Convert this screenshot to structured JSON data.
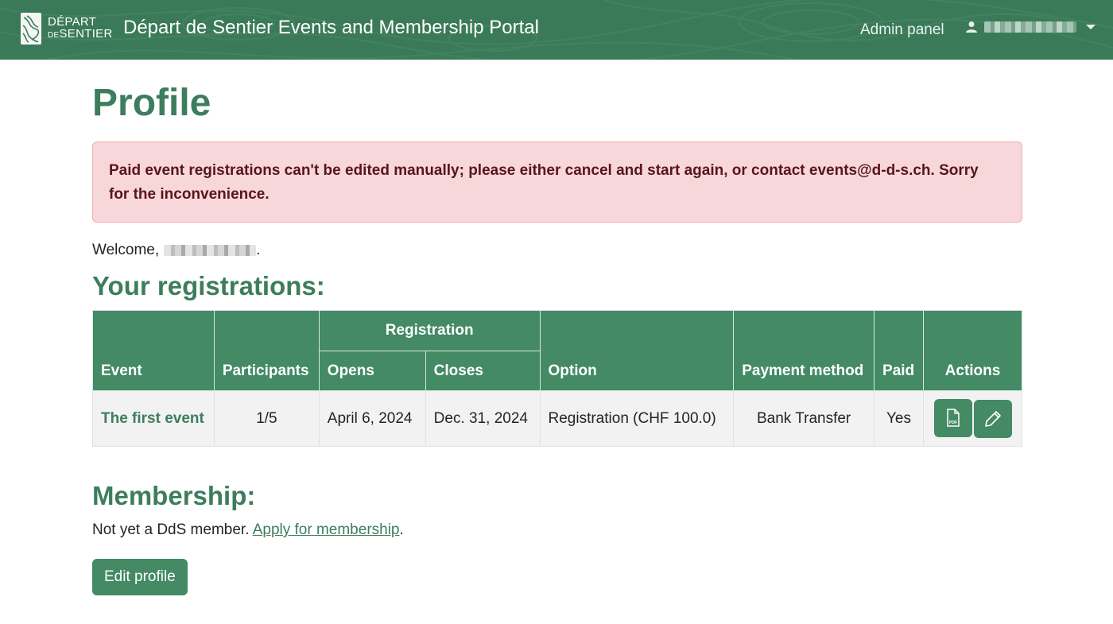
{
  "navbar": {
    "brand_line1": "DÉPART",
    "brand_line2_small": "DE",
    "brand_line2": "SENTIER",
    "title": "Départ de Sentier Events and Membership Portal",
    "admin_link": "Admin panel",
    "user_icon": "user-icon",
    "dropdown_icon": "chevron-down-icon"
  },
  "page": {
    "title": "Profile"
  },
  "alert": {
    "message": "Paid event registrations can't be edited manually; please either cancel and start again, or contact events@d-d-s.ch. Sorry for the inconvenience."
  },
  "welcome": {
    "prefix": "Welcome,",
    "suffix": "."
  },
  "registrations": {
    "heading": "Your registrations:",
    "header_group": "Registration",
    "columns": {
      "event": "Event",
      "participants": "Participants",
      "opens": "Opens",
      "closes": "Closes",
      "option": "Option",
      "payment_method": "Payment method",
      "paid": "Paid",
      "actions": "Actions"
    },
    "rows": [
      {
        "event": "The first event",
        "participants": "1/5",
        "opens": "April 6, 2024",
        "closes": "Dec. 31, 2024",
        "option": "Registration (CHF 100.0)",
        "payment_method": "Bank Transfer",
        "paid": "Yes",
        "actions": [
          "pdf-icon",
          "pencil-icon"
        ]
      }
    ]
  },
  "membership": {
    "heading": "Membership:",
    "text": "Not yet a DdS member.",
    "link": "Apply for membership",
    "link_suffix": "."
  },
  "edit_profile_label": "Edit profile",
  "colors": {
    "primary": "#438a65",
    "navbar": "#3a7a58",
    "heading": "#3d7d5e",
    "alert_bg": "#f8d7da",
    "alert_text": "#58151c"
  }
}
